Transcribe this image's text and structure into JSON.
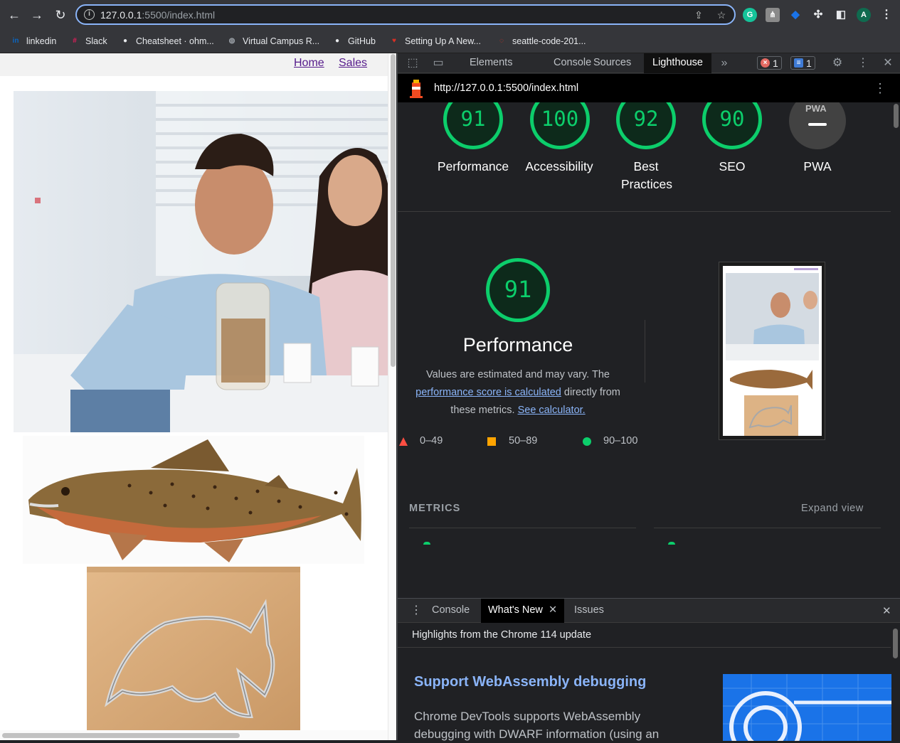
{
  "browser": {
    "url_host": "127.0.0.1",
    "url_rest": ":5500/index.html",
    "profile_initial": "A",
    "bookmarks": [
      {
        "label": "linkedin",
        "icon": "linkedin-icon",
        "color": "#0a66c2",
        "glyph": "in"
      },
      {
        "label": "Slack",
        "icon": "slack-icon",
        "color": "#e01e5a",
        "glyph": "#"
      },
      {
        "label": "Cheatsheet · ohm...",
        "icon": "github-icon",
        "color": "#e8eaed",
        "glyph": "●"
      },
      {
        "label": "Virtual Campus R...",
        "icon": "globe-icon",
        "color": "#9aa0a6",
        "glyph": "◍"
      },
      {
        "label": "GitHub",
        "icon": "github-icon",
        "color": "#e8eaed",
        "glyph": "●"
      },
      {
        "label": "Setting Up A New...",
        "icon": "shield-icon",
        "color": "#d93025",
        "glyph": "♥"
      },
      {
        "label": "seattle-code-201...",
        "icon": "loading-icon",
        "color": "#d93025",
        "glyph": "◌"
      }
    ]
  },
  "page": {
    "nav": [
      {
        "label": "Home"
      },
      {
        "label": "Sales"
      }
    ]
  },
  "devtools": {
    "tabs": [
      "Elements",
      "Console",
      "Sources",
      "Lighthouse"
    ],
    "active_tab": "Lighthouse",
    "error_count": "1",
    "message_count": "1",
    "lighthouse_url": "http://127.0.0.1:5500/index.html",
    "categories": [
      {
        "score": "91",
        "label": "Performance"
      },
      {
        "score": "100",
        "label": "Accessibility"
      },
      {
        "score": "92",
        "label": "Best Practices"
      },
      {
        "score": "90",
        "label": "SEO"
      },
      {
        "score": "",
        "label": "PWA",
        "badge": "PWA"
      }
    ],
    "performance": {
      "score": "91",
      "title": "Performance",
      "desc_1": "Values are estimated and may vary. The",
      "link_1": "performance score is calculated",
      "desc_2": "directly from",
      "desc_3": "these metrics.",
      "link_2": "See calculator."
    },
    "legend": [
      {
        "range": "0–49",
        "color": "#ff4e42",
        "shape": "triangle-icon"
      },
      {
        "range": "50–89",
        "color": "#ffa400",
        "shape": "square-icon"
      },
      {
        "range": "90–100",
        "color": "#0cce6b",
        "shape": "circle-icon"
      }
    ],
    "metrics_header": "METRICS",
    "expand_view": "Expand view",
    "drawer": {
      "tabs": [
        "Console",
        "What's New",
        "Issues"
      ],
      "active_tab": "What's New",
      "highlights": "Highlights from the Chrome 114 update",
      "article_title": "Support WebAssembly debugging",
      "article_text_1": "Chrome DevTools supports WebAssembly",
      "article_text_2": "debugging with DWARF information (using an"
    }
  }
}
